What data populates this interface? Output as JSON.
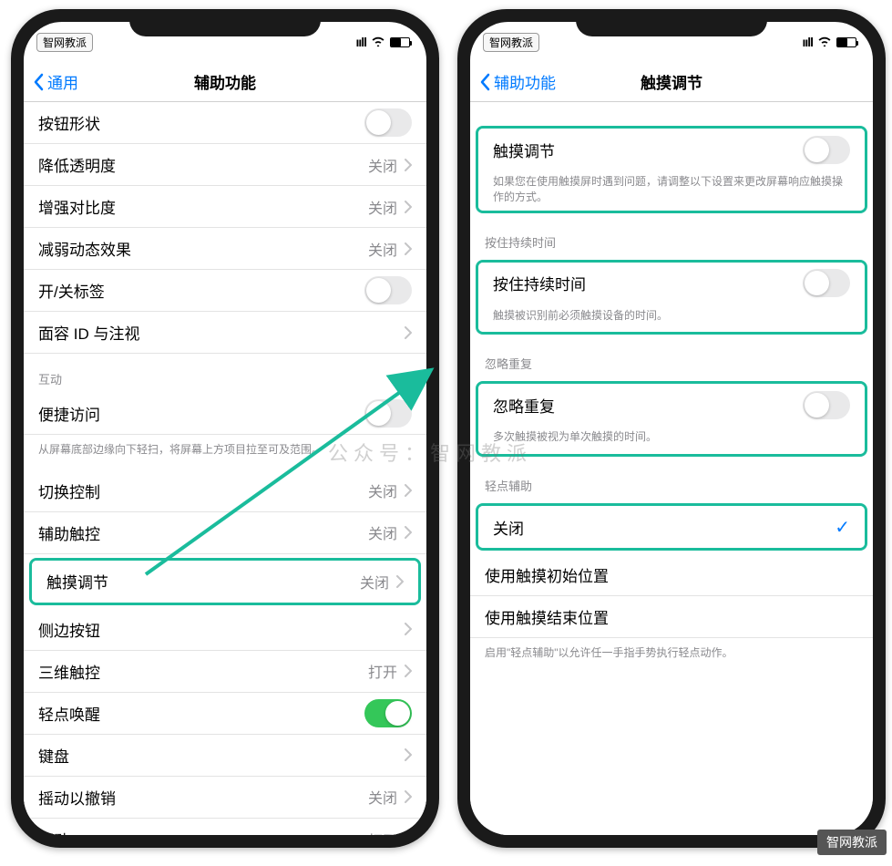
{
  "statusbar": {
    "carrier": "智网教派"
  },
  "watermark": "公众号：智网教派",
  "cornerBadge": "智网教派",
  "left": {
    "back": "通用",
    "title": "辅助功能",
    "rows": {
      "buttonShapes": "按钮形状",
      "reduceTransparency": {
        "label": "降低透明度",
        "value": "关闭"
      },
      "increaseContrast": {
        "label": "增强对比度",
        "value": "关闭"
      },
      "reduceMotion": {
        "label": "减弱动态效果",
        "value": "关闭"
      },
      "onOffLabels": "开/关标签",
      "faceIdAttention": {
        "label": "面容 ID 与注视"
      }
    },
    "sectionInteraction": "互动",
    "reachability": {
      "label": "便捷访问",
      "footer": "从屏幕底部边缘向下轻扫，将屏幕上方项目拉至可及范围。"
    },
    "switchControl": {
      "label": "切换控制",
      "value": "关闭"
    },
    "assistiveTouch": {
      "label": "辅助触控",
      "value": "关闭"
    },
    "touchAccom": {
      "label": "触摸调节",
      "value": "关闭"
    },
    "sideButton": {
      "label": "侧边按钮"
    },
    "threeDTouch": {
      "label": "三维触控",
      "value": "打开"
    },
    "tapToWake": "轻点唤醒",
    "keyboard": "键盘",
    "shakeUndo": {
      "label": "摇动以撤销",
      "value": "关闭"
    },
    "vibration": {
      "label": "振动",
      "value": "打开"
    }
  },
  "right": {
    "back": "辅助功能",
    "title": "触摸调节",
    "touchAccom": {
      "label": "触摸调节",
      "footer": "如果您在使用触摸屏时遇到问题，请调整以下设置来更改屏幕响应触摸操作的方式。"
    },
    "holdHeader": "按住持续时间",
    "holdDuration": {
      "label": "按住持续时间",
      "footer": "触摸被识别前必须触摸设备的时间。"
    },
    "ignoreHeader": "忽略重复",
    "ignoreRepeat": {
      "label": "忽略重复",
      "footer": "多次触摸被视为单次触摸的时间。"
    },
    "tapAssistHeader": "轻点辅助",
    "off": "关闭",
    "useInitial": "使用触摸初始位置",
    "useFinal": "使用触摸结束位置",
    "tapAssistFooter": "启用\"轻点辅助\"以允许任一手指手势执行轻点动作。"
  }
}
